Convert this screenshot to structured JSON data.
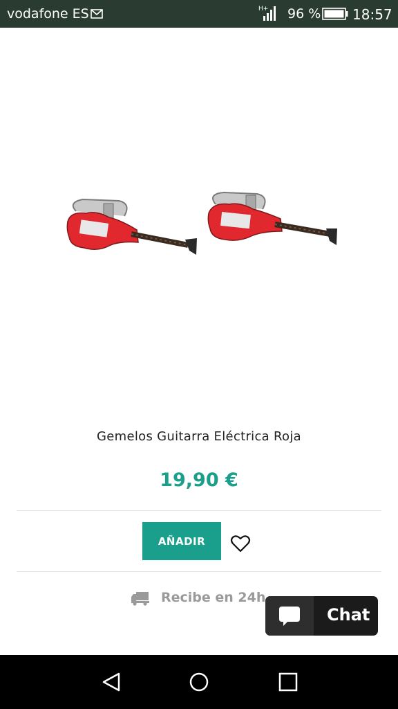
{
  "status_bar": {
    "carrier": "vodafone ES",
    "network": "H+",
    "battery": "96 %",
    "time": "18:57"
  },
  "product": {
    "title": "Gemelos Guitarra Eléctrica Roja",
    "price": "19,90 €",
    "image_icon": "guitar-cufflinks-image"
  },
  "actions": {
    "add_label": "AÑADIR",
    "wishlist_icon": "heart-icon"
  },
  "delivery": {
    "text": "Recibe en 24h.",
    "icon": "truck-icon"
  },
  "chat": {
    "label": "Chat",
    "icon": "chat-bubble-icon"
  },
  "nav": {
    "back_icon": "back-icon",
    "home_icon": "home-icon",
    "recent_icon": "recent-apps-icon"
  },
  "colors": {
    "accent": "#1a9f8c",
    "status_bar": "#2a3b32",
    "guitar_red": "#e0282e"
  }
}
